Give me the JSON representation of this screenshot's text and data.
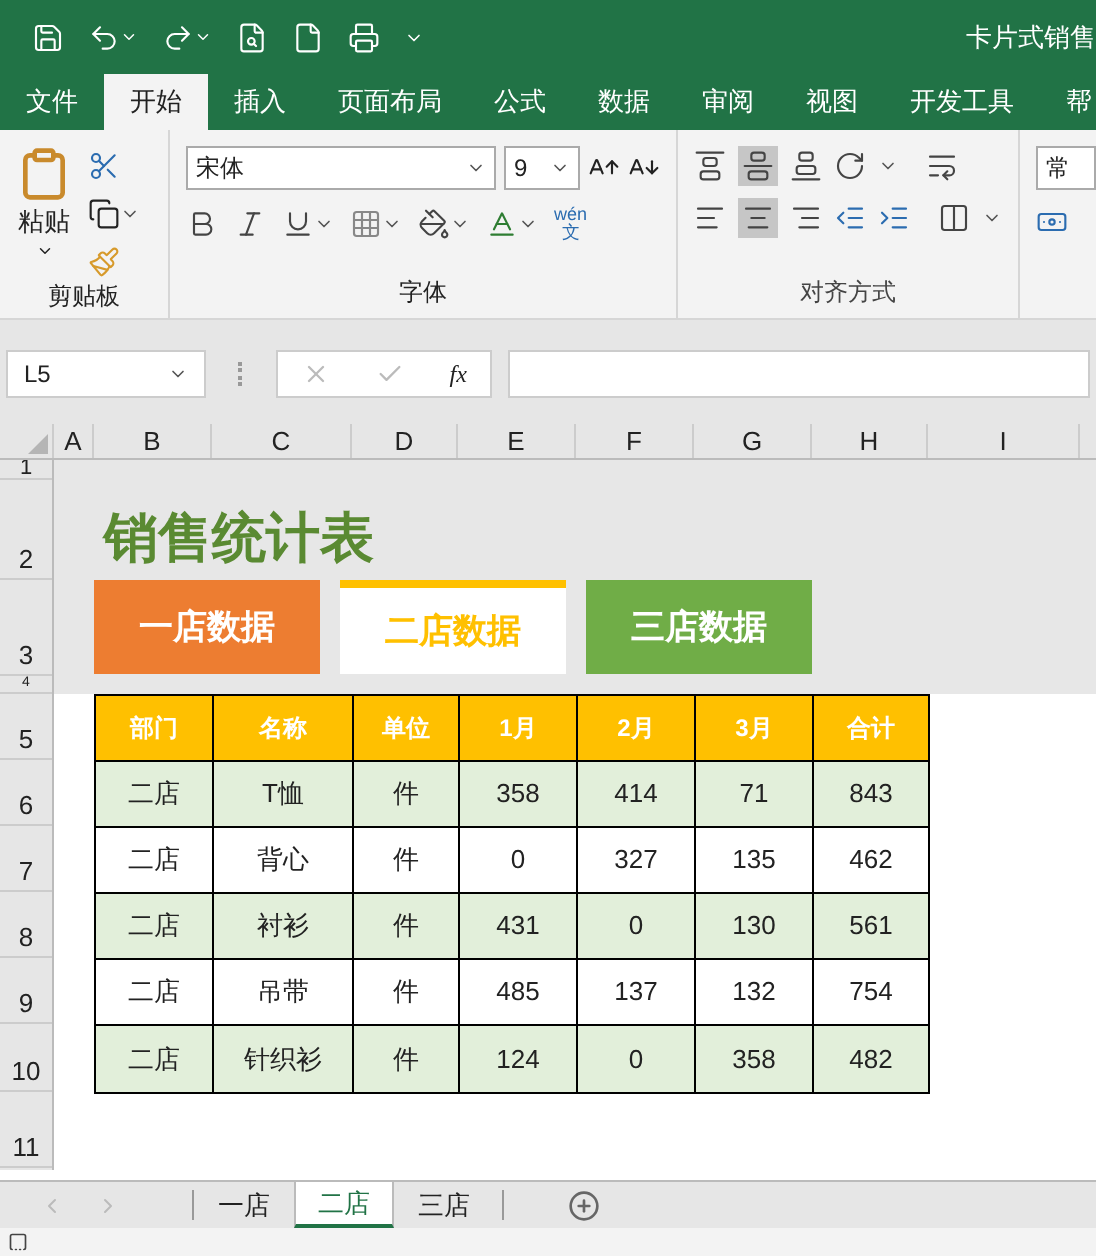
{
  "window": {
    "title": "卡片式销售"
  },
  "ribbon_tabs": [
    {
      "label": "文件",
      "selected": false
    },
    {
      "label": "开始",
      "selected": true
    },
    {
      "label": "插入",
      "selected": false
    },
    {
      "label": "页面布局",
      "selected": false
    },
    {
      "label": "公式",
      "selected": false
    },
    {
      "label": "数据",
      "selected": false
    },
    {
      "label": "审阅",
      "selected": false
    },
    {
      "label": "视图",
      "selected": false
    },
    {
      "label": "开发工具",
      "selected": false
    },
    {
      "label": "帮",
      "selected": false
    }
  ],
  "ribbon": {
    "paste_label": "粘贴",
    "font_name": "宋体",
    "font_size": "9",
    "phonetic_top": "wén",
    "phonetic_bottom": "文",
    "number_format": "常",
    "groups": [
      "剪贴板",
      "字体",
      "对齐方式"
    ]
  },
  "formula_bar": {
    "name_box": "L5",
    "fx": "fx"
  },
  "columns": [
    "A",
    "B",
    "C",
    "D",
    "E",
    "F",
    "G",
    "H",
    "I"
  ],
  "row_numbers": [
    "1",
    "2",
    "3",
    "4",
    "5",
    "6",
    "7",
    "8",
    "9",
    "10",
    "11"
  ],
  "sheet_title": "销售统计表",
  "cards": [
    {
      "label": "一店数据",
      "selected": false,
      "color": "#ed7d31"
    },
    {
      "label": "二店数据",
      "selected": true,
      "color": "#ffc000"
    },
    {
      "label": "三店数据",
      "selected": false,
      "color": "#70ad47"
    }
  ],
  "table": {
    "columns": [
      "部门",
      "名称",
      "单位",
      "1月",
      "2月",
      "3月",
      "合计"
    ],
    "rows": [
      [
        "二店",
        "T恤",
        "件",
        "358",
        "414",
        "71",
        "843"
      ],
      [
        "二店",
        "背心",
        "件",
        "0",
        "327",
        "135",
        "462"
      ],
      [
        "二店",
        "衬衫",
        "件",
        "431",
        "0",
        "130",
        "561"
      ],
      [
        "二店",
        "吊带",
        "件",
        "485",
        "137",
        "132",
        "754"
      ],
      [
        "二店",
        "针织衫",
        "件",
        "124",
        "0",
        "358",
        "482"
      ]
    ]
  },
  "sheet_tabs": [
    {
      "label": "一店",
      "selected": false
    },
    {
      "label": "二店",
      "selected": true
    },
    {
      "label": "三店",
      "selected": false
    }
  ]
}
